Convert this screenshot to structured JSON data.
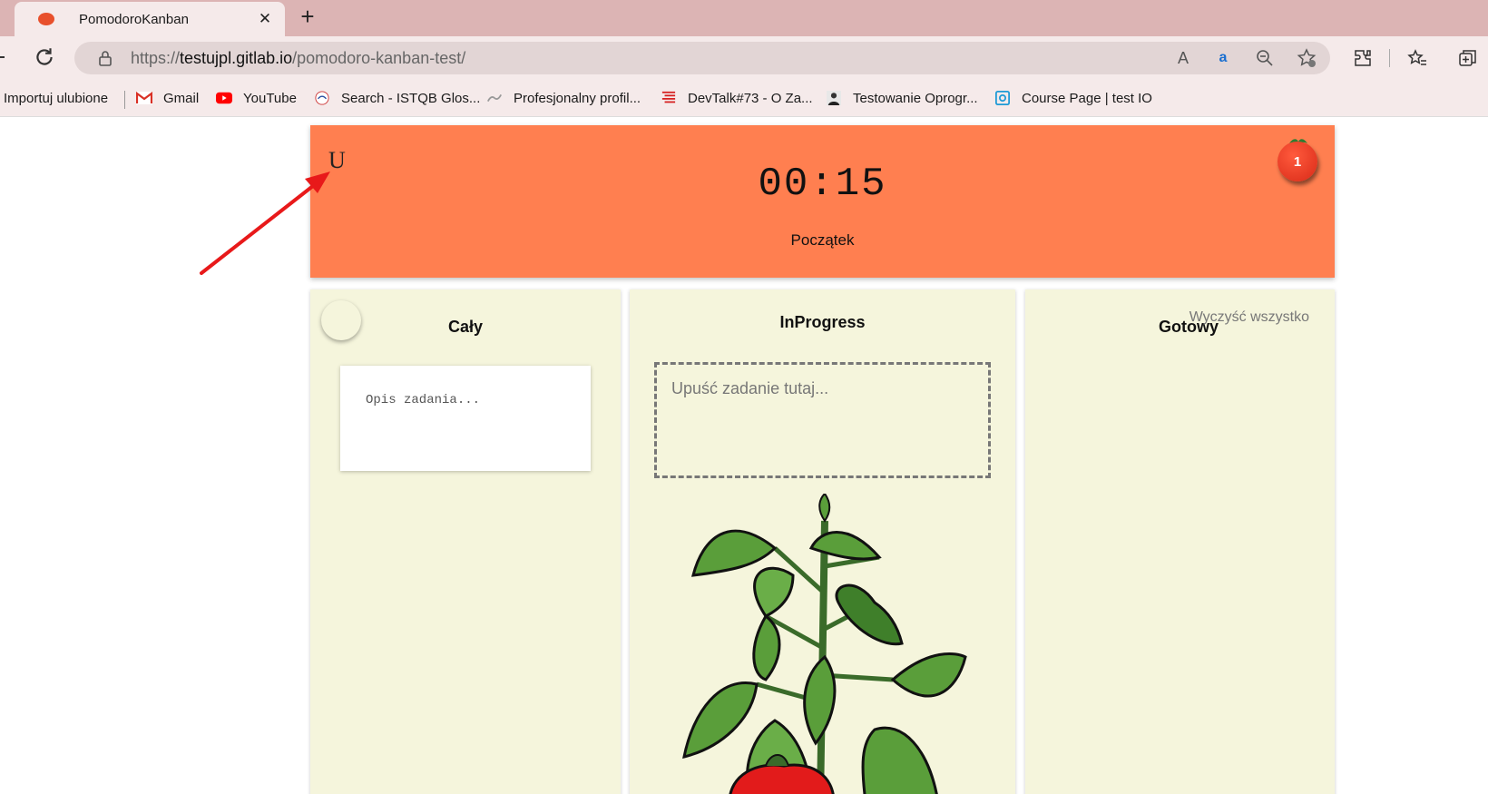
{
  "browser": {
    "tab_title": "PomodoroKanban",
    "tab_close": "✕",
    "new_tab": "+",
    "url_host": "testujpl.gitlab.io",
    "url_scheme": "https://",
    "url_path": "/pomodoro-kanban-test/",
    "bookmarks": [
      {
        "label": "Importuj ulubione",
        "icon": "none"
      },
      {
        "label": "Gmail",
        "icon": "gmail-icon"
      },
      {
        "label": "YouTube",
        "icon": "youtube-icon"
      },
      {
        "label": "Search - ISTQB Glos...",
        "icon": "istqb-icon"
      },
      {
        "label": "Profesjonalny profil...",
        "icon": "profile-icon"
      },
      {
        "label": "DevTalk#73 - O Za...",
        "icon": "devtalk-icon"
      },
      {
        "label": "Testowanie Oprogr...",
        "icon": "person-icon"
      },
      {
        "label": "Course Page | test IO",
        "icon": "testio-icon"
      }
    ]
  },
  "app": {
    "header_letter": "U",
    "timer": "00:15",
    "start_label": "Początek",
    "pomodoro_count": "1",
    "colors": {
      "header": "#ff7f50",
      "column": "#f5f5dc",
      "arrow": "#e8191a"
    }
  },
  "board": {
    "col_all": {
      "title": "Cały",
      "task_placeholder": "Opis zadania..."
    },
    "col_progress": {
      "title": "InProgress",
      "drop_placeholder": "Upuść zadanie tutaj..."
    },
    "col_done": {
      "title": "Gotowy",
      "clear_label": "Wyczyść wszystko"
    }
  }
}
